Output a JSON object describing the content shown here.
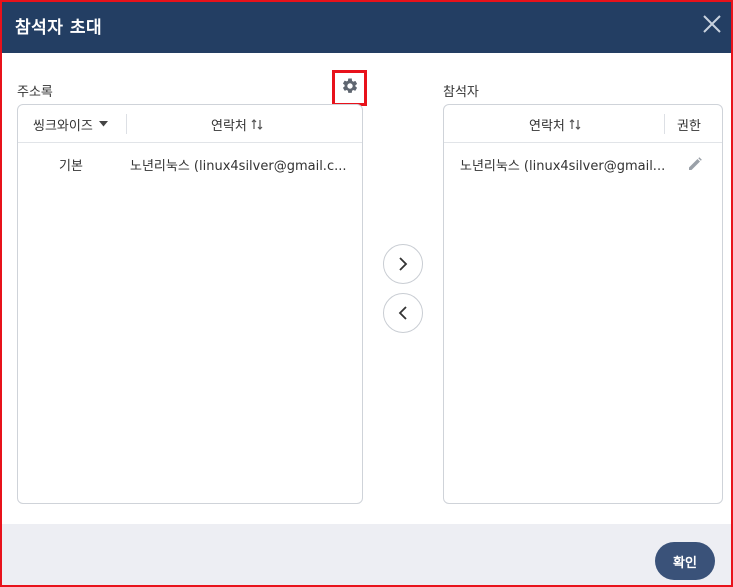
{
  "dialog": {
    "title": "참석자 초대",
    "close_icon": "close-icon"
  },
  "address_book": {
    "label": "주소록",
    "settings_icon": "gear-icon",
    "columns": {
      "sync_wise": "씽크와이즈",
      "contact": "연락처"
    },
    "rows": [
      {
        "group": "기본",
        "contact": "노년리눅스 (linux4silver@gmail.c..."
      }
    ]
  },
  "attendees": {
    "label": "참석자",
    "columns": {
      "contact": "연락처",
      "permission": "권한"
    },
    "rows": [
      {
        "contact": "노년리눅스 (linux4silver@gmail...",
        "edit_icon": "pencil-icon"
      }
    ]
  },
  "controls": {
    "add_icon": "chevron-right-icon",
    "remove_icon": "chevron-left-icon"
  },
  "footer": {
    "confirm_label": "확인"
  },
  "colors": {
    "title_bar": "#233e63",
    "highlight": "#e8121b",
    "confirm_button": "#3a5279",
    "footer_bg": "#edeef3"
  }
}
